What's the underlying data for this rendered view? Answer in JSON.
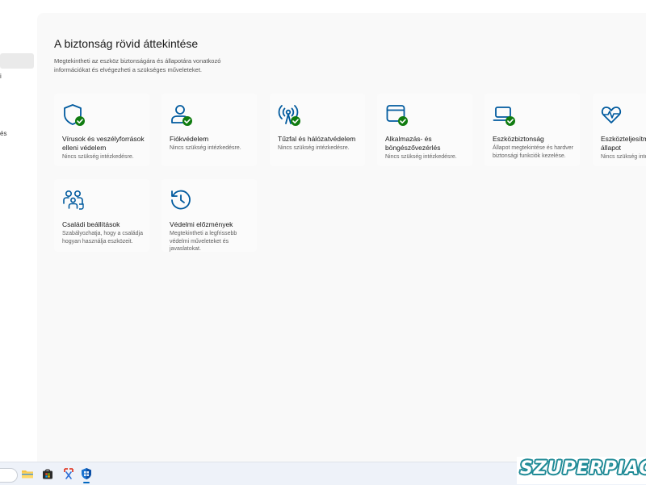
{
  "sidebar": {
    "fragments": [
      "i",
      "és"
    ]
  },
  "main": {
    "title": "A biztonság rövid áttekintése",
    "description": "Megtekintheti az eszköz biztonságára és állapotára vonatkozó információkat és elvégezheti a szükséges műveleteket.",
    "cards": [
      {
        "title": "Vírusok és veszélyforrások elleni védelem",
        "status": "Nincs szükség intézkedésre.",
        "icon": "shield-icon"
      },
      {
        "title": "Fiókvédelem",
        "status": "Nincs szükség intézkedésre.",
        "icon": "person-icon"
      },
      {
        "title": "Tűzfal és hálózatvédelem",
        "status": "Nincs szükség intézkedésre.",
        "icon": "wireless-antenna-icon"
      },
      {
        "title": "Alkalmazás- és böngészővezérlés",
        "status": "Nincs szükség intézkedésre.",
        "icon": "app-window-icon"
      },
      {
        "title": "Eszközbiztonság",
        "status": "Állapot megtekintése és hardver biztonsági funkciók kezelése.",
        "icon": "laptop-icon"
      },
      {
        "title": "Eszközteljesítmény és állapot",
        "status": "Nincs szükség intézkedésre.",
        "icon": "heart-pulse-icon"
      },
      {
        "title": "Családi beállítások",
        "status": "Szabályozhatja, hogy a családja hogyan használja eszközeit.",
        "icon": "family-icon"
      },
      {
        "title": "Védelmi előzmények",
        "status": "Megtekintheti a legfrissebb védelmi műveleteket és javaslatokat.",
        "icon": "history-icon"
      }
    ]
  },
  "taskbar": {
    "items": [
      "search-box",
      "file-explorer-icon",
      "store-icon",
      "snipping-tool-icon",
      "windows-security-icon"
    ]
  },
  "watermark": {
    "text": "SZUPERPIAC"
  },
  "colors": {
    "accent": "#0067c0",
    "icon_blue": "#005a9e",
    "check_green": "#107c10"
  }
}
